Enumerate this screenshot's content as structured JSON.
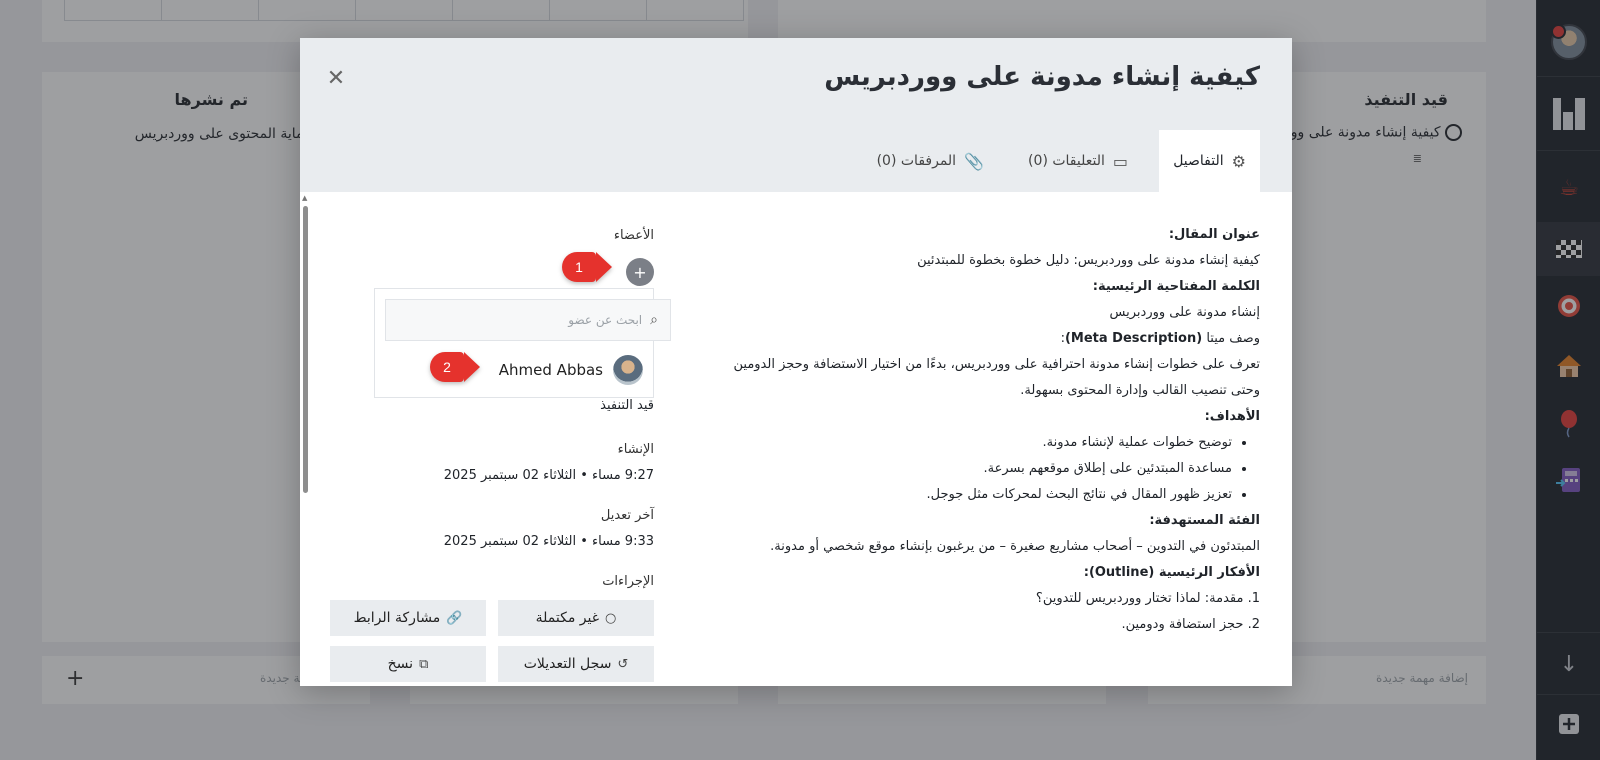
{
  "board": {
    "columns": [
      {
        "title": "تم نشرها",
        "task": "هذا كيفية حماية المحتوى على ووردبريس"
      },
      {
        "title": "قيد التنفيذ",
        "task": "كيفية إنشاء مدونة على ووردبريس"
      }
    ],
    "add_task_label": "إضافة مهمة جديدة",
    "add_icon": "+"
  },
  "rail": {
    "icons": [
      "avatar",
      "logo-icon",
      "coffee-icon",
      "checkered-flag-icon",
      "target-icon",
      "house-icon",
      "balloon-icon",
      "calculator-icon",
      "arrow-down-icon",
      "plus-square-icon"
    ]
  },
  "modal": {
    "title": "كيفية إنشاء مدونة على ووردبريس",
    "close_icon": "✕",
    "tabs": [
      {
        "label": "التفاصيل",
        "icon": "⚙"
      },
      {
        "label": "التعليقات (0)",
        "icon": "▭"
      },
      {
        "label": "المرفقات (0)",
        "icon": "📎"
      }
    ],
    "details": {
      "article_title_label": "عنوان المقال:",
      "article_title": "كيفية إنشاء مدونة على ووردبريس: دليل خطوة بخطوة للمبتدئين",
      "keyword_label": "الكلمة المفتاحية الرئيسية:",
      "keyword": "إنشاء مدونة على ووردبريس",
      "meta_label_prefix": "وصف ميتا ",
      "meta_label_en": "(Meta Description)",
      "meta_label_suffix": ":",
      "meta": "تعرف على خطوات إنشاء مدونة احترافية على ووردبريس، بدءًا من اختيار الاستضافة وحجز الدومين وحتى تنصيب القالب وإدارة المحتوى بسهولة.",
      "goals_label": "الأهداف:",
      "goals": [
        "توضيح خطوات عملية لإنشاء مدونة.",
        "مساعدة المبتدئين على إطلاق موقعهم بسرعة.",
        "تعزيز ظهور المقال في نتائج البحث لمحركات مثل جوجل."
      ],
      "audience_label": "الفئة المستهدفة:",
      "audience": "المبتدئون في التدوين – أصحاب مشاريع صغيرة – من يرغبون بإنشاء موقع شخصي أو مدونة.",
      "outline_label_prefix": "الأفكار الرئيسية ",
      "outline_label_en": "(Outline)",
      "outline_label_suffix": ":",
      "outline": [
        "1. مقدمة: لماذا تختار ووردبريس للتدوين؟",
        "2. حجز استضافة ودومين."
      ]
    },
    "side": {
      "members_label": "الأعضاء",
      "add_member_icon": "+",
      "search_placeholder": "ابحث عن عضو",
      "member_name": "Ahmed Abbas",
      "status": "قيد التنفيذ",
      "created_label": "الإنشاء",
      "created_value": "9:27 مساء • الثلاثاء 02 سبتمبر 2025",
      "modified_label": "آخر تعديل",
      "modified_value": "9:33 مساء • الثلاثاء 02 سبتمبر 2025",
      "actions_label": "الإجراءات",
      "actions": [
        {
          "label": "غير مكتملة",
          "icon": "○"
        },
        {
          "label": "مشاركة الرابط",
          "icon": "🔗"
        },
        {
          "label": "سجل التعديلات",
          "icon": "↺"
        },
        {
          "label": "نسخ",
          "icon": "⧉"
        }
      ]
    },
    "callouts": [
      "1",
      "2"
    ]
  },
  "colors": {
    "overlay": "#282a2e",
    "rail": "#1d2128",
    "callout": "#e5322d",
    "tab_bar": "#e9ecef"
  }
}
